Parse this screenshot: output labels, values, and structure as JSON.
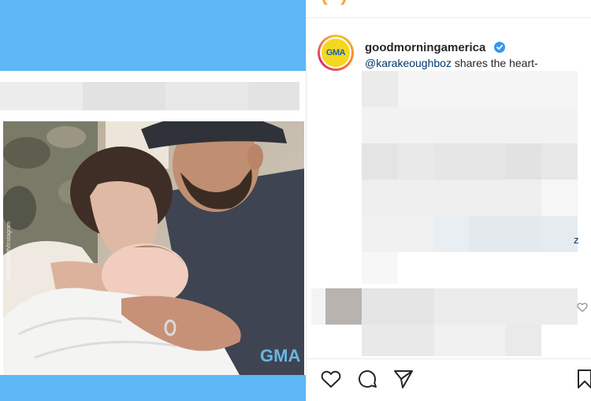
{
  "post": {
    "username": "goodmorningamerica",
    "caption_mention": "@karakeoughboz",
    "caption_text": " shares the heart-",
    "stray_text": "z",
    "avatar_text": "GMA",
    "watermark": "GMA",
    "photo_credit": "Kara Keough/Instagram"
  },
  "colors": {
    "blue_bar": "#5db8f5",
    "verified": "#3897f0",
    "mention": "#00376b"
  },
  "icons": [
    "verified-badge-icon",
    "heart-icon",
    "comment-icon",
    "share-icon",
    "bookmark-icon",
    "heart-small-icon"
  ]
}
